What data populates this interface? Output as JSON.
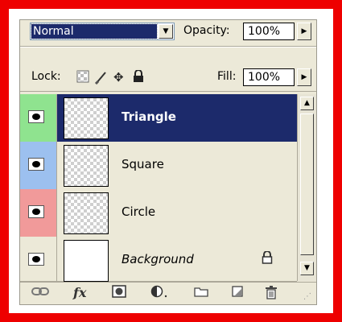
{
  "blend_mode": {
    "value": "Normal",
    "dropdown_icon": "chevron-down-icon"
  },
  "opacity": {
    "label": "Opacity:",
    "value": "100%"
  },
  "lock": {
    "label": "Lock:",
    "icons": [
      "lock-transparent-pixels-icon",
      "lock-image-pixels-icon",
      "lock-position-icon",
      "lock-all-icon"
    ]
  },
  "fill": {
    "label": "Fill:",
    "value": "100%"
  },
  "layers": [
    {
      "name": "Triangle",
      "label_color": "#8fe38f",
      "selected": true
    },
    {
      "name": "Square",
      "label_color": "#9cc0ef",
      "selected": false
    },
    {
      "name": "Circle",
      "label_color": "#f19a9a",
      "selected": false
    },
    {
      "name": "Background",
      "label_color": "#ece9d8",
      "selected": false,
      "locked": true
    }
  ],
  "toolbar": {
    "icons": [
      "link-layers-icon",
      "layer-style-fx-icon",
      "add-mask-icon",
      "adjustment-layer-icon",
      "new-group-icon",
      "new-layer-icon",
      "trash-icon"
    ],
    "fx_label": "fx"
  },
  "colors": {
    "selection": "#1c2a6b",
    "frame": "#ee0000",
    "panel": "#ece9d8"
  }
}
